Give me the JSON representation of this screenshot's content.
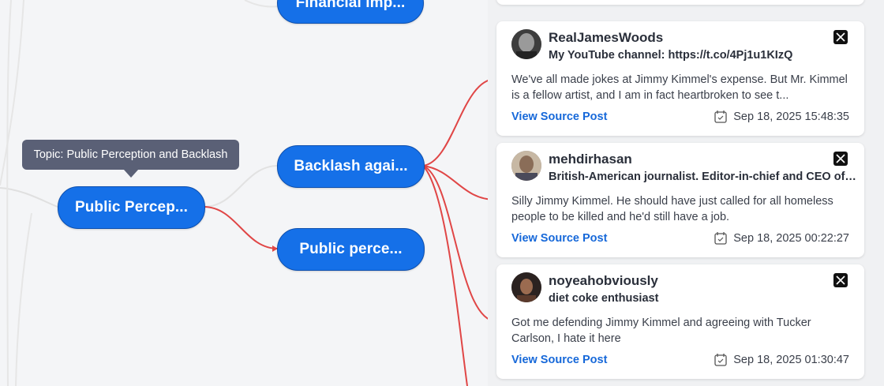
{
  "mindmap": {
    "tooltip": "Topic: Public Perception and Backlash",
    "nodes": {
      "financial": "Financial imp...",
      "public_perception": "Public Percep...",
      "backlash": "Backlash agai...",
      "public_perce": "Public perce..."
    }
  },
  "posts": [
    {
      "username": "RealJamesWoods",
      "bio": "My YouTube channel: https://t.co/4Pj1u1KIzQ",
      "text": "We've all made jokes at Jimmy Kimmel's expense. But Mr. Kimmel is a fellow artist, and I am in fact heartbroken to see t...",
      "link_label": "View Source Post",
      "date": "Sep 18, 2025 15:48:35",
      "source_icon": "x-icon"
    },
    {
      "username": "mehdirhasan",
      "bio": "British-American journalist. Editor-in-chief and CEO of ...",
      "text": "Silly Jimmy Kimmel. He should have just called for all homeless people to be killed and he'd still have a job.",
      "link_label": "View Source Post",
      "date": "Sep 18, 2025 00:22:27",
      "source_icon": "x-icon"
    },
    {
      "username": "noyeahobviously",
      "bio": "diet coke enthusiast",
      "text": "Got me defending Jimmy Kimmel and agreeing with Tucker Carlson, I hate it here",
      "link_label": "View Source Post",
      "date": "Sep 18, 2025 01:30:47",
      "source_icon": "x-icon"
    }
  ],
  "colors": {
    "node": "#1570e8",
    "connector": "#e04646",
    "link": "#1668d9",
    "tooltip": "#5a6076"
  }
}
